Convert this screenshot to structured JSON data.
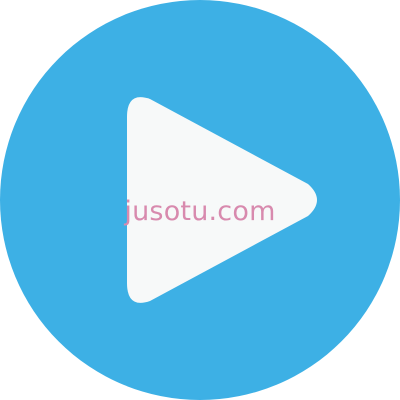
{
  "icon": {
    "name": "play-icon",
    "circle_color": "#3DB0E5",
    "triangle_color": "#F7F9F9"
  },
  "watermark": {
    "text": "jusotu.com",
    "color": "#D88AAE"
  }
}
